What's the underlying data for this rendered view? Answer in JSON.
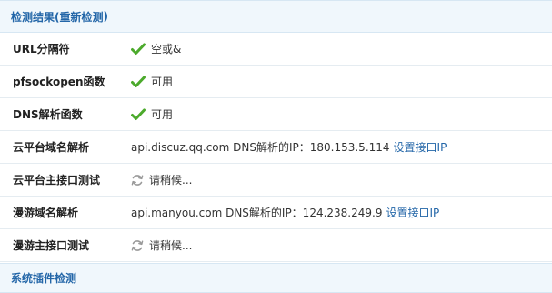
{
  "header": {
    "title": "检测结果(",
    "recheck_label": "重新检测",
    "title_close": ")"
  },
  "rows": [
    {
      "label": "URL分隔符",
      "status": "ok",
      "value": "空或&"
    },
    {
      "label": "pfsockopen函数",
      "status": "ok",
      "value": "可用"
    },
    {
      "label": "DNS解析函数",
      "status": "ok",
      "value": "可用"
    },
    {
      "label": "云平台域名解析",
      "status": "info",
      "value": "api.discuz.qq.com DNS解析的IP：180.153.5.114",
      "link": "设置接口IP"
    },
    {
      "label": "云平台主接口测试",
      "status": "pending",
      "value": "请稍候..."
    },
    {
      "label": "漫游域名解析",
      "status": "info",
      "value": "api.manyou.com DNS解析的IP：124.238.249.9",
      "link": "设置接口IP"
    },
    {
      "label": "漫游主接口测试",
      "status": "pending",
      "value": "请稍候..."
    }
  ],
  "footer_header": {
    "title": "系统插件检测"
  },
  "colors": {
    "accent": "#2366a8",
    "check": "#4caa2c",
    "header_bg": "#f0f7fc"
  },
  "icons": {
    "ok": "check-icon",
    "pending": "refresh-icon"
  }
}
